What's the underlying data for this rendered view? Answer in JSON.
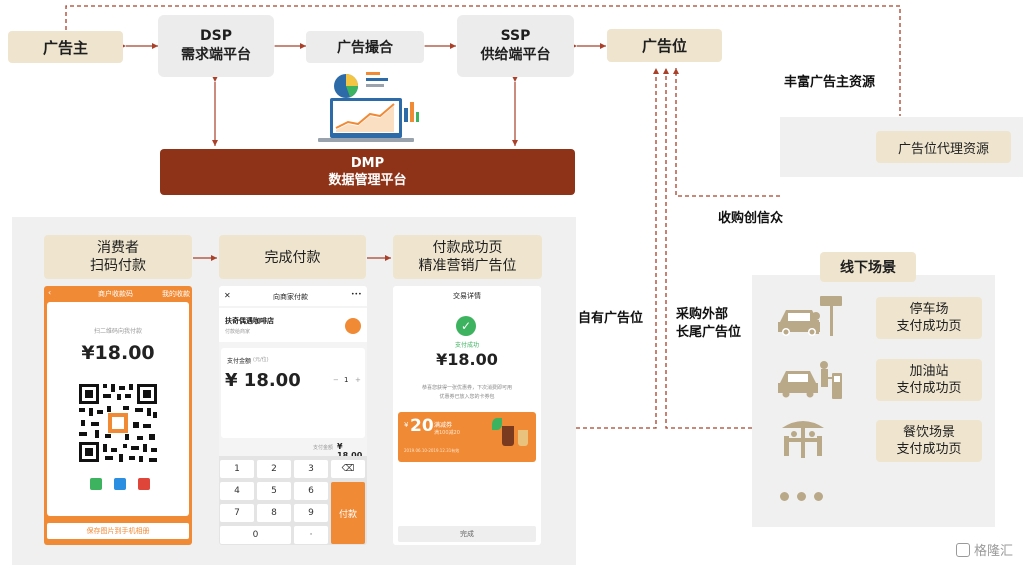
{
  "top": {
    "advertiser": "广告主",
    "dsp": {
      "title": "DSP",
      "subtitle": "需求端平台"
    },
    "ad_exchange": "广告撮合",
    "ssp": {
      "title": "SSP",
      "subtitle": "供给端平台"
    },
    "ad_slot": "广告位",
    "dmp": {
      "title": "DMP",
      "subtitle": "数据管理平台"
    }
  },
  "right": {
    "rich_advertiser_resources": "丰富广告主资源",
    "ad_slot_agency": "广告位代理资源",
    "acquire_label": "收购创信众",
    "own_ad_slot": "自有广告位",
    "procure_line1": "采购外部",
    "procure_line2": "长尾广告位"
  },
  "flow": {
    "step1_line1": "消费者",
    "step1_line2": "扫码付款",
    "step2": "完成付款",
    "step3_line1": "付款成功页",
    "step3_line2": "精准营销广告位"
  },
  "phone1": {
    "header_title": "商户收款码",
    "header_right": "我的收款",
    "caption": "扫二维码向我付款",
    "amount": "¥18.00",
    "save_button": "保存图片到手机相册"
  },
  "phone2": {
    "close": "✕",
    "title": "向商家付款",
    "more": "•••",
    "merchant": "扶奇偶遇咖啡店",
    "merchant_sub": "付款给商家",
    "amount_label": "支付金额",
    "amount_unit": "(元/位)",
    "amount": "¥ 18.00",
    "minus": "−",
    "qty": "1",
    "plus": "+",
    "total_label": "支付金额",
    "total": "¥ 18.00",
    "keys": [
      "1",
      "2",
      "3",
      "4",
      "5",
      "6",
      "7",
      "8",
      "9",
      "0",
      "·"
    ],
    "backspace": "⌫",
    "pay": "付款"
  },
  "phone3": {
    "title": "交易详情",
    "status": "支付成功",
    "amount": "¥18.00",
    "desc_line1": "恭喜您获得一张优惠券，下次消费即可用",
    "desc_line2": "优惠券已放入您的卡券包",
    "coupon_value": "20",
    "coupon_title": "满减券",
    "coupon_sub": "满100减20",
    "coupon_date": "2019.06.10-2019.12.31有效",
    "done": "完成"
  },
  "offline": {
    "title": "线下场景",
    "parking_line1": "停车场",
    "parking_line2": "支付成功页",
    "gas_line1": "加油站",
    "gas_line2": "支付成功页",
    "dining_line1": "餐饮场景",
    "dining_line2": "支付成功页"
  },
  "watermark": "格隆汇",
  "colors": {
    "arrow_red": "#a8402a",
    "dmp_brown": "#8e3318",
    "tan": "#efe5cf",
    "orange": "#f08a35",
    "success_green": "#3db35f"
  }
}
